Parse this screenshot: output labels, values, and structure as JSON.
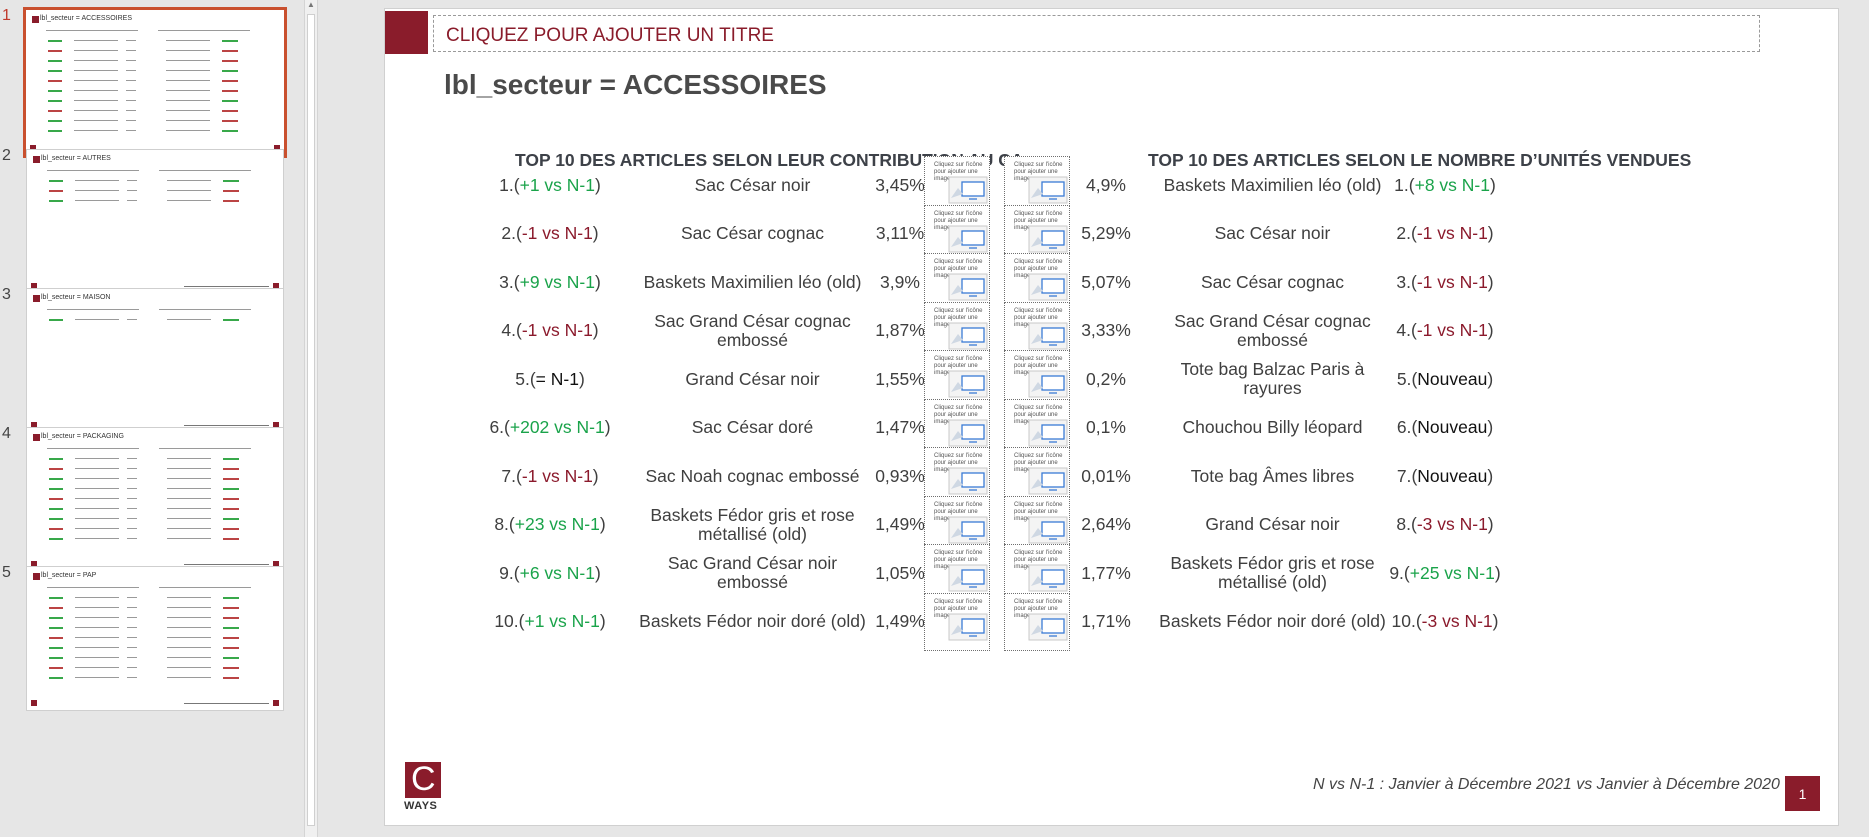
{
  "thumbnails": [
    {
      "num": "1",
      "title": "lbl_secteur = ACCESSOIRES",
      "active": true
    },
    {
      "num": "2",
      "title": "lbl_secteur = AUTRES",
      "active": false
    },
    {
      "num": "3",
      "title": "lbl_secteur = MAISON",
      "active": false
    },
    {
      "num": "4",
      "title": "lbl_secteur = PACKAGING",
      "active": false
    },
    {
      "num": "5",
      "title": "lbl_secteur = PAP",
      "active": false
    }
  ],
  "slide": {
    "title_placeholder": "CLIQUEZ POUR AJOUTER UN TITRE",
    "sector": "lbl_secteur = ACCESSOIRES",
    "left_heading": "TOP 10 DES ARTICLES SELON LEUR CONTRIBUTION AU CA",
    "right_heading": "TOP 10 DES ARTICLES SELON LE NOMBRE D’UNITÉS VENDUES",
    "image_placeholder_text": "Cliquez sur l'icône pour ajouter une image",
    "footnote": "N vs N-1 : Janvier à Décembre 2021 vs Janvier à Décembre 2020",
    "page_number": "1",
    "logo_letter": "C",
    "logo_text": "WAYS"
  },
  "left_rows": [
    {
      "rank": "1.",
      "delta": "+1 vs N-1",
      "tone": "green",
      "article": "Sac César noir",
      "pct": "3,45%"
    },
    {
      "rank": "2.",
      "delta": "-1 vs N-1",
      "tone": "red",
      "article": "Sac César cognac",
      "pct": "3,11%"
    },
    {
      "rank": "3.",
      "delta": "+9 vs N-1",
      "tone": "green",
      "article": "Baskets Maximilien léo (old)",
      "pct": "3,9%"
    },
    {
      "rank": "4.",
      "delta": "-1 vs N-1",
      "tone": "red",
      "article": "Sac Grand César cognac embossé",
      "pct": "1,87%"
    },
    {
      "rank": "5.",
      "delta": "= N-1",
      "tone": "blk",
      "article": "Grand César noir",
      "pct": "1,55%"
    },
    {
      "rank": "6.",
      "delta": "+202 vs N-1",
      "tone": "green",
      "article": "Sac César doré",
      "pct": "1,47%"
    },
    {
      "rank": "7.",
      "delta": "-1 vs N-1",
      "tone": "red",
      "article": "Sac Noah cognac embossé",
      "pct": "0,93%"
    },
    {
      "rank": "8.",
      "delta": "+23 vs N-1",
      "tone": "green",
      "article": "Baskets Fédor gris et rose métallisé (old)",
      "pct": "1,49%"
    },
    {
      "rank": "9.",
      "delta": "+6 vs N-1",
      "tone": "green",
      "article": "Sac Grand César noir embossé",
      "pct": "1,05%"
    },
    {
      "rank": "10.",
      "delta": "+1 vs N-1",
      "tone": "green",
      "article": "Baskets Fédor noir doré (old)",
      "pct": "1,49%"
    }
  ],
  "right_rows": [
    {
      "rank": "1.",
      "delta": "+8 vs N-1",
      "tone": "green",
      "article": "Baskets Maximilien léo (old)",
      "pct": "4,9%"
    },
    {
      "rank": "2.",
      "delta": "-1 vs N-1",
      "tone": "red",
      "article": "Sac César noir",
      "pct": "5,29%"
    },
    {
      "rank": "3.",
      "delta": "-1 vs N-1",
      "tone": "red",
      "article": "Sac César cognac",
      "pct": "5,07%"
    },
    {
      "rank": "4.",
      "delta": "-1 vs N-1",
      "tone": "red",
      "article": "Sac Grand César cognac embossé",
      "pct": "3,33%"
    },
    {
      "rank": "5.",
      "delta": "Nouveau",
      "tone": "blk",
      "article": "Tote bag Balzac Paris à rayures",
      "pct": "0,2%"
    },
    {
      "rank": "6.",
      "delta": "Nouveau",
      "tone": "blk",
      "article": "Chouchou Billy léopard",
      "pct": "0,1%"
    },
    {
      "rank": "7.",
      "delta": "Nouveau",
      "tone": "blk",
      "article": "Tote bag Âmes libres",
      "pct": "0,01%"
    },
    {
      "rank": "8.",
      "delta": "-3 vs N-1",
      "tone": "red",
      "article": "Grand César noir",
      "pct": "2,64%"
    },
    {
      "rank": "9.",
      "delta": "+25 vs N-1",
      "tone": "green",
      "article": "Baskets Fédor gris et rose métallisé (old)",
      "pct": "1,77%"
    },
    {
      "rank": "10.",
      "delta": "-3 vs N-1",
      "tone": "red",
      "article": "Baskets Fédor noir doré (old)",
      "pct": "1,71%"
    }
  ],
  "colors": {
    "brand": "#8a1c2b",
    "positive": "#1aa34a",
    "negative": "#8b1a2c",
    "thumb_active_border": "#c9502e"
  }
}
